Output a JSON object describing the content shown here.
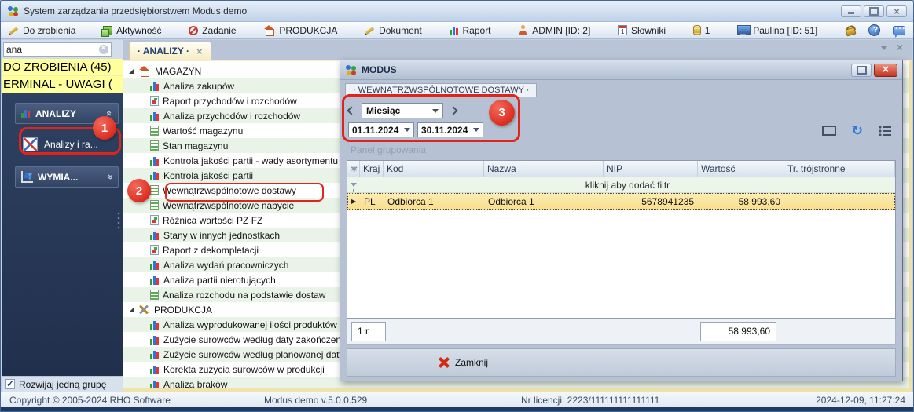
{
  "window": {
    "title": "System zarządzania przedsiębiorstwem Modus demo"
  },
  "toolbar": {
    "items": [
      {
        "label": "Do zrobienia",
        "icon": "pencil-icon"
      },
      {
        "label": "Aktywność",
        "icon": "activity-icon"
      },
      {
        "label": "Zadanie",
        "icon": "no-entry-icon"
      },
      {
        "label": "PRODUKCJA",
        "icon": "home-icon"
      },
      {
        "label": "Dokument",
        "icon": "pencil-icon"
      },
      {
        "label": "Raport",
        "icon": "bar-chart-icon"
      },
      {
        "label": "ADMIN [ID: 2]",
        "icon": "user-icon"
      },
      {
        "label": "Słowniki",
        "icon": "calendar-icon"
      },
      {
        "label": "1",
        "icon": "coins-icon"
      },
      {
        "label": "Paulina [ID: 51]",
        "icon": "monitor-icon"
      }
    ]
  },
  "sidebar": {
    "search_value": "ana",
    "shortcuts": [
      "DO ZROBIENIA (45)",
      "ERMINAL - UWAGI ("
    ],
    "analizy_group_label": "ANALIZY",
    "analizy_item_label": "Analizy i ra...",
    "wymiana_group_label": "WYMIA...",
    "expand_checkbox_label": "Rozwijaj jedną grupę"
  },
  "tabbar": {
    "active_tab": "· ANALIZY ·"
  },
  "tree": {
    "group1": "MAGAZYN",
    "group1_items": [
      "Analiza zakupów",
      "Raport przychodów i rozchodów",
      "Analiza przychodów i rozchodów",
      "Wartość magazynu",
      "Stan magazynu",
      "Kontrola jakości partii - wady asortymentu",
      "Kontrola jakości partii",
      "Wewnątrzwspólnotowe dostawy",
      "Wewnątrzwspólnotowe nabycie",
      "Różnica wartości PZ FZ",
      "Stany w innych jednostkach",
      "Raport z dekompletacji",
      "Analiza wydań pracowniczych",
      "Analiza partii nierotujących",
      "Analiza rozchodu na podstawie dostaw"
    ],
    "group2": "PRODUKCJA",
    "group2_items": [
      "Analiza wyprodukowanej ilości produktów",
      "Zużycie surowców według daty zakończenia p",
      "Zużycie surowców według planowanej daty z",
      "Korekta zużycia surowców w produkcji",
      "Analiza braków"
    ]
  },
  "dialog": {
    "title": "MODUS",
    "tab": "· WEWNĄTRZWSPÓLNOTOWE DOSTAWY ·",
    "period_selector": "Miesiąc",
    "date_from": "01.11.2024",
    "date_to": "30.11.2024",
    "group_panel_text": "Panel grupowania",
    "table": {
      "columns": [
        "Kraj",
        "Kod",
        "Nazwa",
        "NIP",
        "Wartość",
        "Tr. trójstronne"
      ],
      "filter_hint": "kliknij aby dodać filtr",
      "row": [
        "PL",
        "Odbiorca 1",
        "Odbiorca 1",
        "5678941235",
        "58 993,60",
        ""
      ]
    },
    "summary_count": "1 r",
    "summary_total": "58 993,60",
    "close_label": "Zamknij"
  },
  "statusbar": {
    "copyright": "Copyright © 2005-2024 RHO Software",
    "version": "Modus demo v.5.0.0.529",
    "license": "Nr licencji: 2223/111111111111111",
    "datetime": "2024-12-09,  11:27:24"
  },
  "annotations": {
    "step1": "1",
    "step2": "2",
    "step3": "3"
  },
  "colors": {
    "annotation_red": "#e0241b",
    "selected_row_yellow": "#f9de8d",
    "shortcut_yellow": "#ffff9c",
    "sidebar_navy": "#2a3b59"
  }
}
